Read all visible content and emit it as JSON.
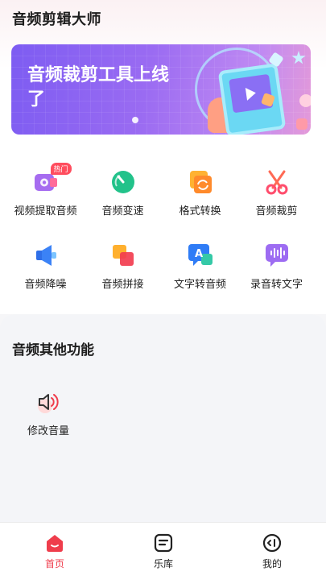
{
  "header": {
    "title": "音频剪辑大师"
  },
  "banner": {
    "text": "音频裁剪工具上线了"
  },
  "features": [
    {
      "label": "视频提取音频",
      "icon": "video-extract-icon",
      "badge": "热门"
    },
    {
      "label": "音频变速",
      "icon": "speed-icon"
    },
    {
      "label": "格式转换",
      "icon": "convert-icon"
    },
    {
      "label": "音频裁剪",
      "icon": "scissors-icon"
    },
    {
      "label": "音频降噪",
      "icon": "speaker-icon"
    },
    {
      "label": "音频拼接",
      "icon": "merge-icon"
    },
    {
      "label": "文字转音频",
      "icon": "text-to-audio-icon"
    },
    {
      "label": "录音转文字",
      "icon": "voice-to-text-icon"
    }
  ],
  "other": {
    "title": "音频其他功能",
    "items": [
      {
        "label": "修改音量",
        "icon": "volume-icon"
      }
    ]
  },
  "nav": {
    "items": [
      {
        "label": "首页",
        "icon": "home-icon",
        "active": true
      },
      {
        "label": "乐库",
        "icon": "library-icon",
        "active": false
      },
      {
        "label": "我的",
        "icon": "profile-icon",
        "active": false
      }
    ]
  },
  "colors": {
    "accent": "#ef3d4c",
    "banner_start": "#7d5cf2",
    "banner_end": "#e59ad8"
  }
}
